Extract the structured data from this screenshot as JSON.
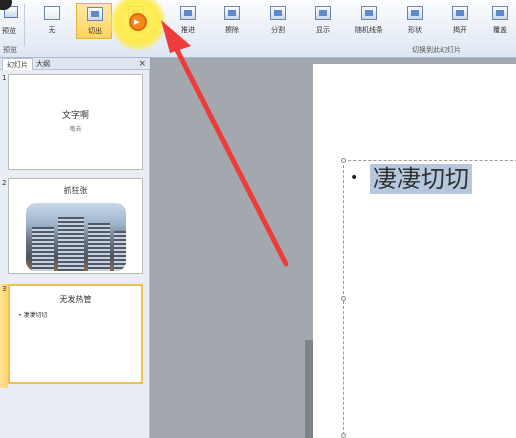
{
  "ribbon": {
    "preview_label": "预览",
    "group_left_label": "预览",
    "group_main_label": "切换到此幻灯片",
    "buttons": [
      {
        "label": "无"
      },
      {
        "label": "切出"
      },
      {
        "label": "淡出"
      },
      {
        "label": "推进"
      },
      {
        "label": "擦除"
      },
      {
        "label": "分割"
      },
      {
        "label": "显示"
      },
      {
        "label": "随机线条"
      },
      {
        "label": "形状"
      },
      {
        "label": "揭开"
      },
      {
        "label": "覆盖"
      }
    ]
  },
  "left_panel": {
    "tabs": [
      "幻灯片",
      "大纲"
    ],
    "close_symbol": "×",
    "slides": [
      {
        "number": "1",
        "title": "文字啊",
        "subtitle": "哦去"
      },
      {
        "number": "2",
        "title": "抓狂张"
      },
      {
        "number": "3",
        "title": "无发热管",
        "bullet": "• 凄凄切切"
      }
    ]
  },
  "editor": {
    "bullet": "•",
    "text": "凄凄切切"
  },
  "colors": {
    "selected_button": "#ffd25e",
    "click_highlight": "#fff35f",
    "arrow": "#ee3b3b",
    "text_selection": "#b5c8dd"
  }
}
